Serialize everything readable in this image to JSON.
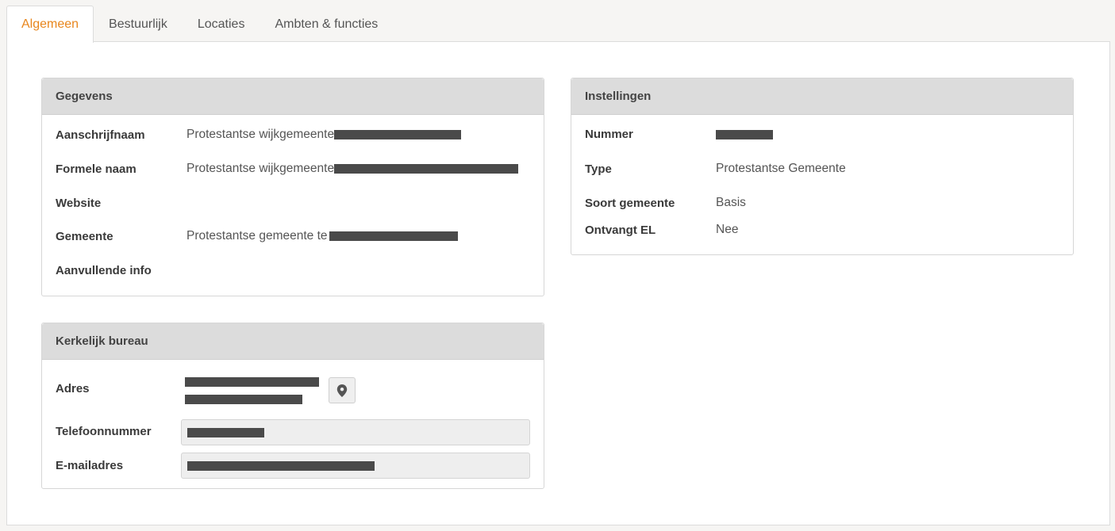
{
  "tabs": [
    {
      "label": "Algemeen",
      "active": true
    },
    {
      "label": "Bestuurlijk",
      "active": false
    },
    {
      "label": "Locaties",
      "active": false
    },
    {
      "label": "Ambten & functies",
      "active": false
    }
  ],
  "accent_color": "#e8861d",
  "gegevens": {
    "title": "Gegevens",
    "rows": [
      {
        "label": "Aanschrijfnaam",
        "value": "Protestantse wijkgemeente"
      },
      {
        "label": "Formele naam",
        "value": "Protestantse wijkgemeente"
      },
      {
        "label": "Website",
        "value": ""
      },
      {
        "label": "Gemeente",
        "value": "Protestantse gemeente te"
      },
      {
        "label": "Aanvullende info",
        "value": ""
      }
    ]
  },
  "instellingen": {
    "title": "Instellingen",
    "rows": [
      {
        "label": "Nummer",
        "value": ""
      },
      {
        "label": "Type",
        "value": "Protestantse Gemeente"
      },
      {
        "label": "Soort gemeente",
        "value": "Basis"
      },
      {
        "label": "Ontvangt EL",
        "value": "Nee"
      }
    ]
  },
  "bureau": {
    "title": "Kerkelijk bureau",
    "adres_label": "Adres",
    "map_icon": "map-marker-icon",
    "telefoon_label": "Telefoonnummer",
    "email_label": "E-mailadres"
  }
}
